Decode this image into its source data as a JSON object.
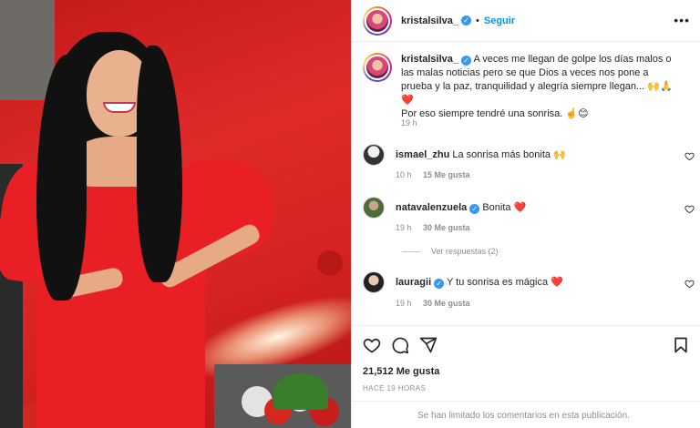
{
  "post": {
    "username": "kristalsilva_",
    "follow_label": "Seguir",
    "more_label": "•••"
  },
  "caption": {
    "username": "kristalsilva_",
    "text": "A veces me llegan de golpe los días malos o las malas noticias pero se que Dios a veces nos pone a prueba y la paz, tranquilidad y alegría siempre llegan... 🙌🙏❤️",
    "text2": "Por eso siempre tendré una sonrisa. ☝️😊",
    "time": "19 h"
  },
  "comments": [
    {
      "username": "ismael_zhu",
      "verified": false,
      "text": "La sonrisa más bonita 🙌",
      "time": "10 h",
      "likes": "15 Me gusta"
    },
    {
      "username": "natavalenzuela",
      "verified": true,
      "text": "Bonita ❤️",
      "time": "19 h",
      "likes": "30 Me gusta"
    },
    {
      "username": "lauragii",
      "verified": true,
      "text": "Y tu sonrisa es mágica ❤️",
      "time": "19 h",
      "likes": "30 Me gusta"
    }
  ],
  "view_replies": "Ver respuestas (2)",
  "likes_count": "21,512 Me gusta",
  "posted_ago": "HACE 19 HORAS",
  "comments_limited": "Se han limitado los comentarios en esta publicación.",
  "icons": {
    "like": "heart-icon",
    "comment": "comment-icon",
    "share": "share-icon",
    "save": "bookmark-icon",
    "verified": "verified-badge-icon",
    "comment_like": "heart-icon"
  },
  "colors": {
    "accent": "#0095f6",
    "verified": "#3897f0",
    "red_heart": "#ed4956",
    "muted": "#8e8e8e"
  }
}
